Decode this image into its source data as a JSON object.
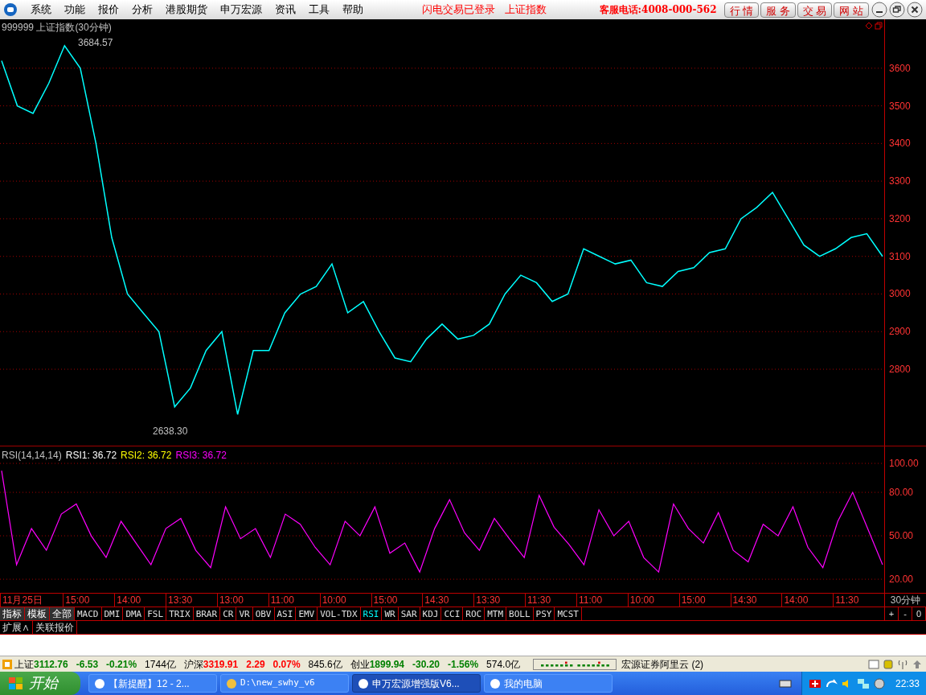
{
  "menu": {
    "items": [
      "系统",
      "功能",
      "报价",
      "分析",
      "港股期货",
      "申万宏源",
      "资讯",
      "工具",
      "帮助"
    ],
    "status_texts": [
      "闪电交易已登录",
      "上证指数"
    ],
    "hotline": "客服电话:4008-000-562",
    "buttons": [
      "行 情",
      "服 务",
      "交 易",
      "网 站"
    ]
  },
  "price_pane": {
    "title": "999999 上证指数(30分钟)",
    "high_label": "3684.57",
    "low_label": "2638.30",
    "chart_data": {
      "type": "line",
      "grid": true,
      "ylim": [
        2597,
        3730
      ],
      "yticks": [
        2800,
        2900,
        3000,
        3100,
        3200,
        3300,
        3400,
        3500,
        3600
      ],
      "series": [
        {
          "color": "#00ffff",
          "values": [
            3620,
            3500,
            3480,
            3560,
            3660,
            3600,
            3400,
            3150,
            3000,
            2950,
            2900,
            2700,
            2750,
            2850,
            2900,
            2680,
            2850,
            2850,
            2950,
            3000,
            3020,
            3080,
            2950,
            2980,
            2900,
            2830,
            2820,
            2880,
            2920,
            2880,
            2890,
            2920,
            3000,
            3050,
            3030,
            2980,
            3000,
            3120,
            3100,
            3080,
            3090,
            3030,
            3020,
            3060,
            3070,
            3110,
            3120,
            3200,
            3230,
            3270,
            3200,
            3130,
            3100,
            3120,
            3150,
            3160,
            3100
          ]
        }
      ]
    }
  },
  "rsi_pane": {
    "label": "RSI(14,14,14)",
    "readings": [
      {
        "text": "RSI1: 36.72",
        "color": "#ffffff"
      },
      {
        "text": "RSI2: 36.72",
        "color": "#ffff00"
      },
      {
        "text": "RSI3: 36.72",
        "color": "#ff00ff"
      }
    ],
    "chart_data": {
      "type": "line",
      "grid": true,
      "ylim": [
        10.6,
        111.7
      ],
      "yticks": [
        {
          "value": 20,
          "label": "20.00"
        },
        {
          "value": 50,
          "label": "50.00"
        },
        {
          "value": 80,
          "label": "80.00"
        },
        {
          "value": 100,
          "label": "100.00"
        }
      ],
      "series": [
        {
          "color": "#ff00ff",
          "values": [
            95,
            30,
            55,
            40,
            65,
            72,
            50,
            35,
            60,
            45,
            30,
            55,
            62,
            40,
            28,
            70,
            48,
            55,
            35,
            65,
            58,
            42,
            30,
            60,
            50,
            70,
            38,
            45,
            25,
            55,
            75,
            52,
            40,
            62,
            48,
            35,
            78,
            56,
            44,
            30,
            68,
            50,
            60,
            35,
            25,
            72,
            55,
            45,
            66,
            40,
            32,
            58,
            50,
            70,
            42,
            28,
            60,
            80,
            55,
            30
          ]
        }
      ]
    }
  },
  "time_axis": {
    "labels": [
      "11月25日",
      "15:00",
      "14:00",
      "13:30",
      "13:00",
      "11:00",
      "10:00",
      "15:00",
      "14:30",
      "13:30",
      "11:30",
      "11:00",
      "10:00",
      "15:00",
      "14:30",
      "14:00",
      "11:30"
    ],
    "period": "30分钟"
  },
  "panel_buttons": [
    "指标",
    "模板",
    "全部"
  ],
  "indicator_tabs": [
    {
      "label": "MACD",
      "selected": false
    },
    {
      "label": "DMI",
      "selected": false
    },
    {
      "label": "DMA",
      "selected": false
    },
    {
      "label": "FSL",
      "selected": false
    },
    {
      "label": "TRIX",
      "selected": false
    },
    {
      "label": "BRAR",
      "selected": false
    },
    {
      "label": "CR",
      "selected": false
    },
    {
      "label": "VR",
      "selected": false
    },
    {
      "label": "OBV",
      "selected": false
    },
    {
      "label": "ASI",
      "selected": false
    },
    {
      "label": "EMV",
      "selected": false
    },
    {
      "label": "VOL-TDX",
      "selected": false
    },
    {
      "label": "RSI",
      "selected": true
    },
    {
      "label": "WR",
      "selected": false
    },
    {
      "label": "SAR",
      "selected": false
    },
    {
      "label": "KDJ",
      "selected": false
    },
    {
      "label": "CCI",
      "selected": false
    },
    {
      "label": "ROC",
      "selected": false
    },
    {
      "label": "MTM",
      "selected": false
    },
    {
      "label": "BOLL",
      "selected": false
    },
    {
      "label": "PSY",
      "selected": false
    },
    {
      "label": "MCST",
      "selected": false
    }
  ],
  "zoom_buttons": [
    "+",
    "-",
    "0"
  ],
  "extra_tabs": [
    "扩展∧",
    "关联报价"
  ],
  "status_bar": {
    "indices": [
      {
        "name": "上证",
        "value": "3112.76",
        "change": "-6.53",
        "pct": "-0.21%",
        "volume": "1744亿",
        "color": "#008000"
      },
      {
        "name": "沪深",
        "value": "3319.91",
        "change": "2.29",
        "pct": "0.07%",
        "volume": "845.6亿",
        "color": "#ff0000"
      },
      {
        "name": "创业",
        "value": "1899.94",
        "change": "-30.20",
        "pct": "-1.56%",
        "volume": "574.0亿",
        "color": "#008000"
      }
    ],
    "server": "宏源证券阿里云 (2)"
  },
  "taskbar": {
    "start": "开始",
    "tasks": [
      {
        "label": "【新提醒】12 - 2...",
        "selected": false
      },
      {
        "label": "D:\\new_swhy_v6",
        "selected": false
      },
      {
        "label": "申万宏源增强版V6...",
        "selected": true
      },
      {
        "label": "我的电脑",
        "selected": false
      }
    ],
    "clock": "22:33"
  }
}
